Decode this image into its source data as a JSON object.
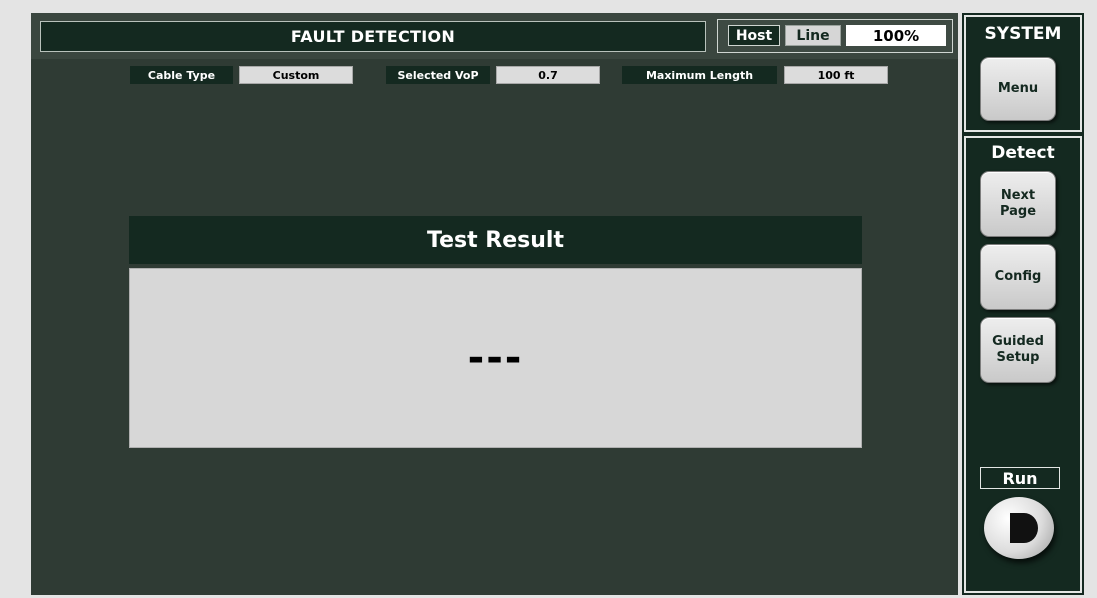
{
  "header": {
    "title": "FAULT DETECTION",
    "status": {
      "host": "Host",
      "line": "Line",
      "percent": "100%"
    }
  },
  "info": [
    {
      "label": "Cable Type",
      "value": "Custom"
    },
    {
      "label": "Selected VoP",
      "value": "0.7"
    },
    {
      "label": "Maximum Length",
      "value": "100 ft"
    }
  ],
  "result": {
    "title": "Test Result",
    "value": "---"
  },
  "sidebar": {
    "system_title": "SYSTEM",
    "menu_label": "Menu",
    "detect_title": "Detect",
    "buttons": [
      {
        "label": "Next\nPage"
      },
      {
        "label": "Config"
      },
      {
        "label": "Guided\nSetup"
      }
    ],
    "run_label": "Run",
    "run_icon": "run-knob-icon"
  },
  "colors": {
    "panel_bg": "#2f3b34",
    "dark_green": "#142920",
    "result_bg": "#d7d7d7"
  }
}
